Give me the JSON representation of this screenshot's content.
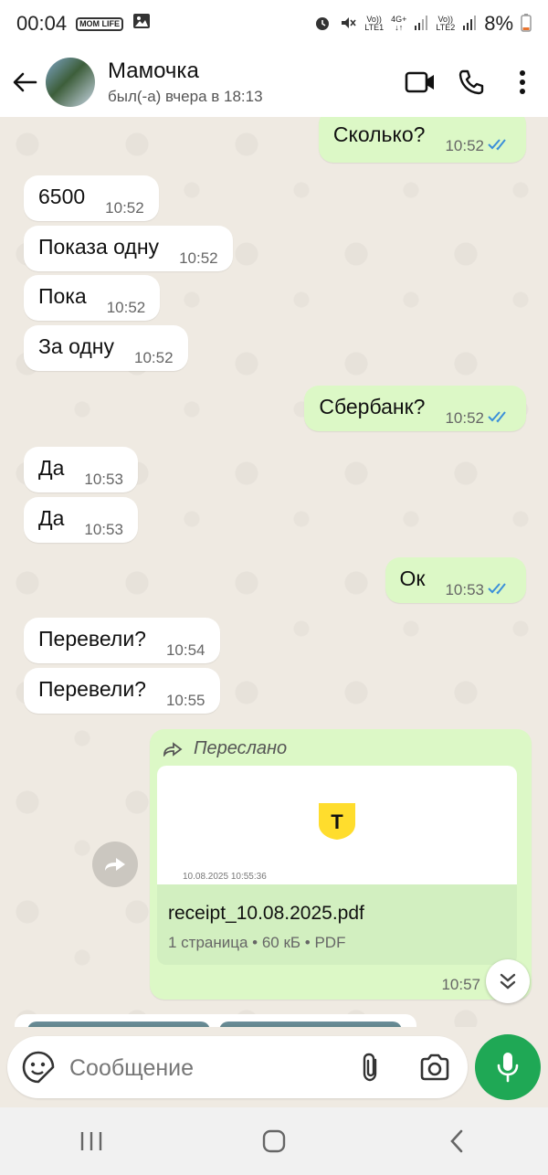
{
  "status_bar": {
    "time": "00:04",
    "mini_badge": "MOM LIFE",
    "battery": "8%",
    "net1_top": "Vo))",
    "net1_bottom": "LTE1",
    "net2_top": "4G+",
    "net3_top": "Vo))",
    "net3_bottom": "LTE2"
  },
  "header": {
    "contact_name": "Мамочка",
    "last_seen": "был(-а) вчера в 18:13"
  },
  "messages": [
    {
      "text": "Сколько?",
      "time": "10:52",
      "dir": "out"
    },
    {
      "text": "6500",
      "time": "10:52",
      "dir": "in"
    },
    {
      "text": "Показа одну",
      "time": "10:52",
      "dir": "in"
    },
    {
      "text": "Пока",
      "time": "10:52",
      "dir": "in"
    },
    {
      "text": "За одну",
      "time": "10:52",
      "dir": "in"
    },
    {
      "text": "Сбербанк?",
      "time": "10:52",
      "dir": "out"
    },
    {
      "text": "Да",
      "time": "10:53",
      "dir": "in"
    },
    {
      "text": "Да",
      "time": "10:53",
      "dir": "in"
    },
    {
      "text": "Ок",
      "time": "10:53",
      "dir": "out"
    },
    {
      "text": "Перевели?",
      "time": "10:54",
      "dir": "in"
    },
    {
      "text": "Перевели?",
      "time": "10:55",
      "dir": "in"
    }
  ],
  "forwarded": {
    "label": "Переслано",
    "preview_date": "10.08.2025 10:55:36",
    "file_name": "receipt_10.08.2025.pdf",
    "file_meta": "1 страница • 60 кБ • PDF",
    "time": "10:57",
    "logo_letter": "T"
  },
  "composer": {
    "placeholder": "Сообщение"
  },
  "colors": {
    "outgoing_bubble": "#dcf8c6",
    "incoming_bubble": "#ffffff",
    "chat_bg": "#efeae2",
    "mic_button": "#1fa855",
    "read_ticks": "#3b8fd9"
  }
}
